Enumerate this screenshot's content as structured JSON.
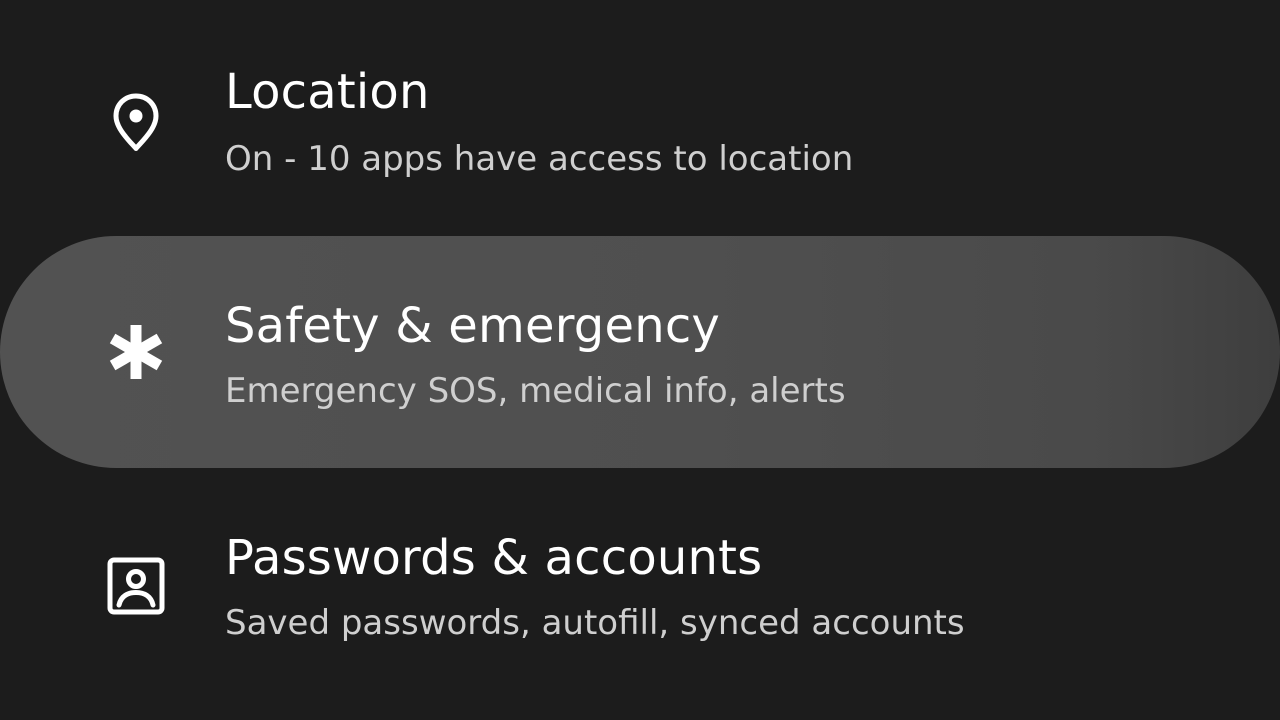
{
  "settings": {
    "items": [
      {
        "title": "Location",
        "subtitle": "On - 10 apps have access to location",
        "icon": "location-pin-icon",
        "highlighted": false
      },
      {
        "title": "Safety & emergency",
        "subtitle": "Emergency SOS, medical info, alerts",
        "icon": "asterisk-icon",
        "highlighted": true
      },
      {
        "title": "Passwords & accounts",
        "subtitle": "Saved passwords, autofill, synced accounts",
        "icon": "account-box-icon",
        "highlighted": false
      }
    ]
  },
  "colors": {
    "background": "#1c1c1c",
    "highlight": "#4f4f4f",
    "title_text": "#ffffff",
    "subtitle_text": "#cfcfcf"
  }
}
